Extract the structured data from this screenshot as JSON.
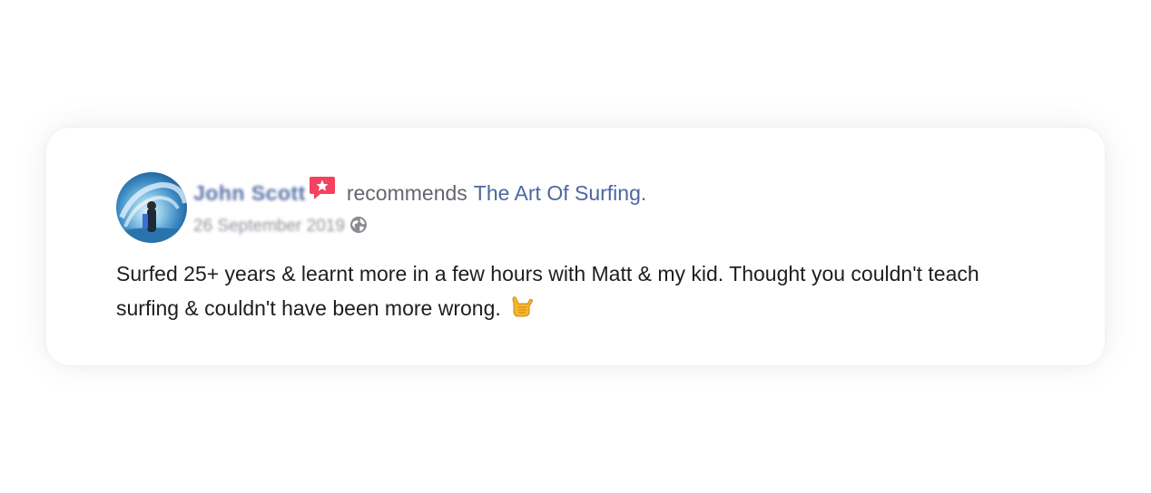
{
  "post": {
    "author_name": "John Scott",
    "verb": "recommends",
    "page_name": "The Art Of Surfing.",
    "date": "26 September 2019",
    "privacy_icon": "globe-icon",
    "recommend_icon": "recommend-star-icon",
    "body_text": "Surfed 25+ years & learnt more in a few hours with Matt & my kid. Thought you couldn't teach surfing & couldn't have been more wrong.",
    "emoji": "🤙"
  },
  "colors": {
    "link": "#4b67a1",
    "author": "#3b5998",
    "secondary_text": "#616770",
    "meta_text": "#90949c",
    "body_text": "#1c1e21",
    "recommend_badge": "#f3425f"
  }
}
